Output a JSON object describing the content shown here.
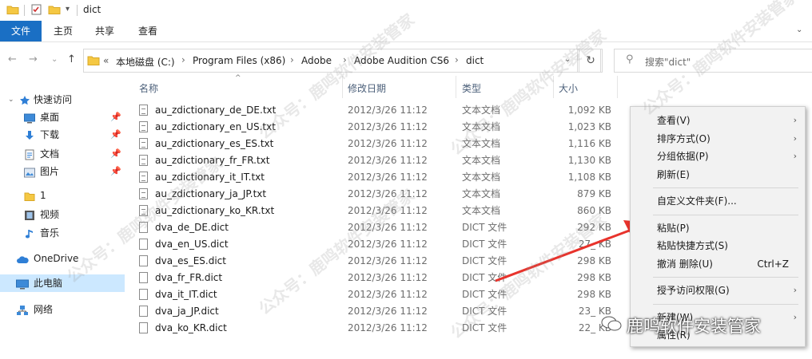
{
  "window": {
    "title": "dict"
  },
  "ribbon": {
    "tabs": [
      "文件",
      "主页",
      "共享",
      "查看"
    ]
  },
  "address": {
    "prefix": "«",
    "crumbs": [
      "本地磁盘 (C:)",
      "Program Files (x86)",
      "Adobe",
      "Adobe Audition CS6",
      "dict"
    ]
  },
  "search": {
    "placeholder": "搜索\"dict\""
  },
  "sidebar": {
    "items": [
      {
        "label": "快速访问",
        "icon": "star-icon",
        "pinned": false
      },
      {
        "label": "桌面",
        "icon": "desktop-icon",
        "pinned": true
      },
      {
        "label": "下载",
        "icon": "download-icon",
        "pinned": true
      },
      {
        "label": "文档",
        "icon": "document-icon",
        "pinned": true
      },
      {
        "label": "图片",
        "icon": "picture-icon",
        "pinned": true
      },
      {
        "label": "1",
        "icon": "folder-icon",
        "pinned": false
      },
      {
        "label": "视频",
        "icon": "video-icon",
        "pinned": false
      },
      {
        "label": "音乐",
        "icon": "music-icon",
        "pinned": false
      },
      {
        "label": "OneDrive",
        "icon": "cloud-icon",
        "pinned": false
      },
      {
        "label": "此电脑",
        "icon": "computer-icon",
        "pinned": false
      },
      {
        "label": "网络",
        "icon": "network-icon",
        "pinned": false
      }
    ],
    "selected": "此电脑"
  },
  "columns": {
    "name": "名称",
    "modified": "修改日期",
    "type": "类型",
    "size": "大小"
  },
  "files": [
    {
      "name": "au_zdictionary_de_DE.txt",
      "modified": "2012/3/26 11:12",
      "type": "文本文档",
      "size": "1,092 KB",
      "kind": "txt"
    },
    {
      "name": "au_zdictionary_en_US.txt",
      "modified": "2012/3/26 11:12",
      "type": "文本文档",
      "size": "1,023 KB",
      "kind": "txt"
    },
    {
      "name": "au_zdictionary_es_ES.txt",
      "modified": "2012/3/26 11:12",
      "type": "文本文档",
      "size": "1,116 KB",
      "kind": "txt"
    },
    {
      "name": "au_zdictionary_fr_FR.txt",
      "modified": "2012/3/26 11:12",
      "type": "文本文档",
      "size": "1,130 KB",
      "kind": "txt"
    },
    {
      "name": "au_zdictionary_it_IT.txt",
      "modified": "2012/3/26 11:12",
      "type": "文本文档",
      "size": "1,108 KB",
      "kind": "txt"
    },
    {
      "name": "au_zdictionary_ja_JP.txt",
      "modified": "2012/3/26 11:12",
      "type": "文本文档",
      "size": "879 KB",
      "kind": "txt"
    },
    {
      "name": "au_zdictionary_ko_KR.txt",
      "modified": "2012/3/26 11:12",
      "type": "文本文档",
      "size": "860 KB",
      "kind": "txt"
    },
    {
      "name": "dva_de_DE.dict",
      "modified": "2012/3/26 11:12",
      "type": "DICT 文件",
      "size": "292 KB",
      "kind": "dict"
    },
    {
      "name": "dva_en_US.dict",
      "modified": "2012/3/26 11:12",
      "type": "DICT 文件",
      "size": "27_ KB",
      "kind": "dict"
    },
    {
      "name": "dva_es_ES.dict",
      "modified": "2012/3/26 11:12",
      "type": "DICT 文件",
      "size": "298 KB",
      "kind": "dict"
    },
    {
      "name": "dva_fr_FR.dict",
      "modified": "2012/3/26 11:12",
      "type": "DICT 文件",
      "size": "298 KB",
      "kind": "dict"
    },
    {
      "name": "dva_it_IT.dict",
      "modified": "2012/3/26 11:12",
      "type": "DICT 文件",
      "size": "298 KB",
      "kind": "dict"
    },
    {
      "name": "dva_ja_JP.dict",
      "modified": "2012/3/26 11:12",
      "type": "DICT 文件",
      "size": "23_ KB",
      "kind": "dict"
    },
    {
      "name": "dva_ko_KR.dict",
      "modified": "2012/3/26 11:12",
      "type": "DICT 文件",
      "size": "22_ KB",
      "kind": "dict"
    }
  ],
  "context_menu": {
    "groups": [
      [
        {
          "label": "查看(V)",
          "submenu": true
        },
        {
          "label": "排序方式(O)",
          "submenu": true
        },
        {
          "label": "分组依据(P)",
          "submenu": true
        },
        {
          "label": "刷新(E)",
          "submenu": false
        }
      ],
      [
        {
          "label": "自定义文件夹(F)...",
          "submenu": false
        }
      ],
      [
        {
          "label": "粘贴(P)",
          "submenu": false
        },
        {
          "label": "粘贴快捷方式(S)",
          "submenu": false
        },
        {
          "label": "撤消 删除(U)",
          "submenu": false,
          "shortcut": "Ctrl+Z"
        }
      ],
      [
        {
          "label": "授予访问权限(G)",
          "submenu": true
        }
      ],
      [
        {
          "label": "新建(W)",
          "submenu": true
        },
        {
          "label": "属性(R)",
          "submenu": false
        }
      ]
    ]
  },
  "watermark": {
    "text": "公众号：鹿鸣软件安装管家",
    "brand": "鹿鸣软件安装管家"
  },
  "colors": {
    "accent": "#1a6fc4",
    "selection": "#cce8ff",
    "arrow": "#e8332c"
  }
}
